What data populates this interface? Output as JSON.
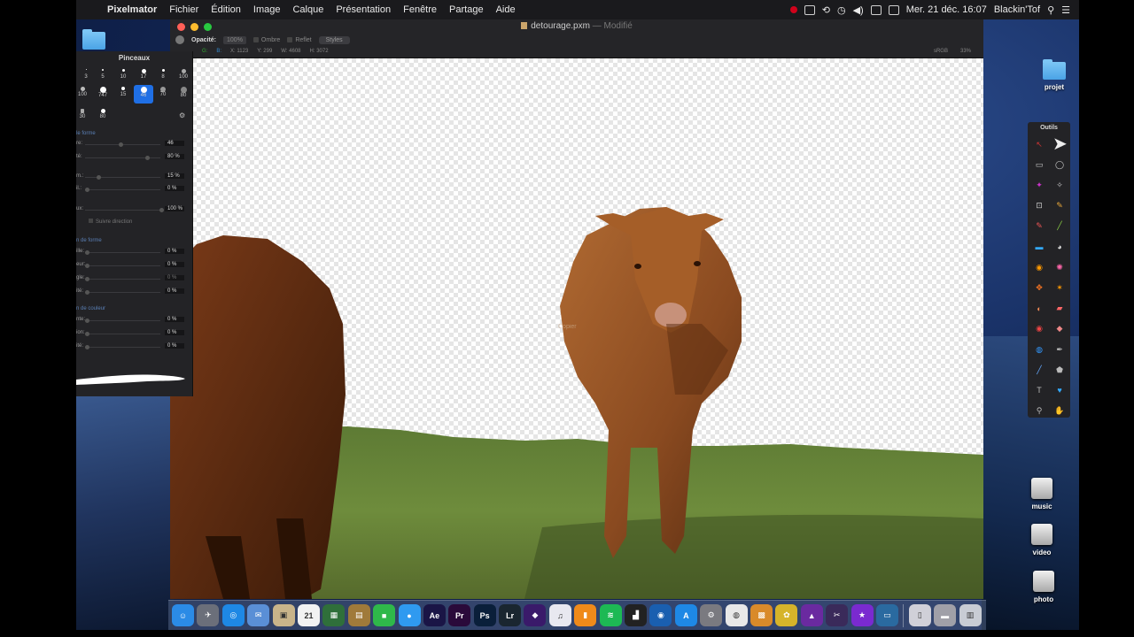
{
  "menubar": {
    "app_name": "Pixelmator",
    "items": [
      "Fichier",
      "Édition",
      "Image",
      "Calque",
      "Présentation",
      "Fenêtre",
      "Partage",
      "Aide"
    ],
    "status_icons": [
      "record-icon",
      "screen-mirror-icon",
      "time-machine-icon",
      "clock-icon",
      "volume-icon",
      "input-menu-icon",
      "battery-icon"
    ],
    "datetime": "Mer. 21 déc. 16:07",
    "user": "Blackin'Tof"
  },
  "window": {
    "title": "detourage.pxm",
    "title_suffix": "— Modifié",
    "toolbar": {
      "opacity_label": "Opacité:",
      "opacity_value": "100%",
      "shadow_label": "Ombre",
      "reflection_label": "Reflet",
      "styles_label": "Styles"
    },
    "info": {
      "g": "G:",
      "b": "B:",
      "x": "X: 1123",
      "y": "Y: 299",
      "w": "W: 4608",
      "h": "H: 3072",
      "color_profile": "sRGB",
      "zoom": "33%"
    },
    "canvas_hint": "Copier"
  },
  "brushes_panel": {
    "title": "Pinceaux",
    "brushes": [
      "3",
      "5",
      "10",
      "17",
      "8",
      "100",
      "100",
      "747",
      "15",
      "46",
      "70",
      "80",
      "30",
      "80"
    ],
    "selected_brush": "46",
    "section_shape": "le forme",
    "sliders_top": [
      {
        "label": "re:",
        "value": "46",
        "knob": 0.45
      },
      {
        "label": "té:",
        "value": "80 %",
        "knob": 0.8
      }
    ],
    "sliders_mid": [
      {
        "label": "m.:",
        "value": "15 %",
        "knob": 0.2
      },
      {
        "label": "il.:",
        "value": "0 %",
        "knob": 0.0
      }
    ],
    "slider_flux": {
      "label": "ux:",
      "value": "100 %",
      "knob": 1.0
    },
    "follow_direction": "Suivre direction",
    "section_shape_dyn": "n de forme",
    "sliders_shape": [
      {
        "label": "ille:",
        "value": "0 %"
      },
      {
        "label": "eur:",
        "value": "0 %"
      },
      {
        "label": "gle:",
        "value": "0 %"
      },
      {
        "label": "ité:",
        "value": "0 %"
      }
    ],
    "section_color": "n de couleur",
    "sliders_color": [
      {
        "label": "nte:",
        "value": "0 %"
      },
      {
        "label": "ion:",
        "value": "0 %"
      },
      {
        "label": "ité:",
        "value": "0 %"
      }
    ]
  },
  "tools_panel": {
    "title": "Outils",
    "tools": [
      "move-icon",
      "select-icon",
      "rect-select-icon",
      "ellipse-select-icon",
      "magic-wand-icon",
      "lasso-icon",
      "crop-icon",
      "eyedropper-icon",
      "pencil-icon",
      "brush-icon",
      "fill-icon",
      "gradient-icon",
      "blob-icon",
      "clone-icon",
      "smudge-icon",
      "burn-icon",
      "sponge-icon",
      "eraser-icon",
      "redeye-icon",
      "healing-icon",
      "drop-icon",
      "pen-icon",
      "line-icon",
      "shape-icon",
      "text-icon",
      "heart-shape-icon",
      "zoom-icon",
      "hand-icon"
    ]
  },
  "desktop_icons": [
    {
      "label": "",
      "kind": "folder"
    },
    {
      "label": "projet",
      "kind": "folder"
    },
    {
      "label": "music",
      "kind": "drive"
    },
    {
      "label": "video",
      "kind": "drive"
    },
    {
      "label": "photo",
      "kind": "drive"
    }
  ],
  "dock": {
    "apps": [
      {
        "name": "finder-icon",
        "glyph": "☺",
        "color": "#2b8be6"
      },
      {
        "name": "launchpad-icon",
        "glyph": "✈",
        "color": "#6b6f7a"
      },
      {
        "name": "safari-icon",
        "glyph": "◎",
        "color": "#1e88e5"
      },
      {
        "name": "mail-icon",
        "glyph": "✉",
        "color": "#5a8fd6"
      },
      {
        "name": "preview-icon",
        "glyph": "▣",
        "color": "#c9b48a"
      },
      {
        "name": "calendar-icon",
        "glyph": "21",
        "color": "#f2f2f2"
      },
      {
        "name": "mosaic-icon",
        "glyph": "▦",
        "color": "#2f6f3a"
      },
      {
        "name": "notes-icon",
        "glyph": "▤",
        "color": "#a07a3a"
      },
      {
        "name": "facetime-icon",
        "glyph": "■",
        "color": "#2fb84a"
      },
      {
        "name": "messages-icon",
        "glyph": "●",
        "color": "#2f9af0"
      },
      {
        "name": "after-effects-icon",
        "glyph": "Ae",
        "color": "#1a1546"
      },
      {
        "name": "premiere-icon",
        "glyph": "Pr",
        "color": "#2a0a3a"
      },
      {
        "name": "photoshop-icon",
        "glyph": "Ps",
        "color": "#0a1f3a"
      },
      {
        "name": "lightroom-icon",
        "glyph": "Lr",
        "color": "#1a2630"
      },
      {
        "name": "motion-icon",
        "glyph": "◆",
        "color": "#3a1a6a"
      },
      {
        "name": "itunes-icon",
        "glyph": "♫",
        "color": "#e8e8f0"
      },
      {
        "name": "ibooks-icon",
        "glyph": "▮",
        "color": "#f08a1a"
      },
      {
        "name": "spotify-icon",
        "glyph": "≋",
        "color": "#1db954"
      },
      {
        "name": "activity-icon",
        "glyph": "▟",
        "color": "#222222"
      },
      {
        "name": "network-icon",
        "glyph": "◉",
        "color": "#1a5fb0"
      },
      {
        "name": "app-store-icon",
        "glyph": "A",
        "color": "#1e88e5"
      },
      {
        "name": "system-prefs-icon",
        "glyph": "⚙",
        "color": "#7a7a80"
      },
      {
        "name": "chrome-icon",
        "glyph": "◍",
        "color": "#e8e8e8"
      },
      {
        "name": "image-capture-icon",
        "glyph": "▩",
        "color": "#d98a2a"
      },
      {
        "name": "pixelmator-icon",
        "glyph": "✿",
        "color": "#d6b42a"
      },
      {
        "name": "affinity-icon",
        "glyph": "▲",
        "color": "#6a2aa0"
      },
      {
        "name": "final-cut-icon",
        "glyph": "✂",
        "color": "#3a2a5a"
      },
      {
        "name": "imovie-icon",
        "glyph": "★",
        "color": "#7a2ad0"
      },
      {
        "name": "screen-sharing-icon",
        "glyph": "▭",
        "color": "#2a6aa0"
      },
      {
        "name": "documents-stack-icon",
        "glyph": "▯",
        "color": "#d0d0d8"
      },
      {
        "name": "downloads-stack-icon",
        "glyph": "▬",
        "color": "#a0a0a8"
      },
      {
        "name": "trash-icon",
        "glyph": "▥",
        "color": "#c8ccd4"
      }
    ]
  },
  "colors": {
    "accent": "#1f6fe5",
    "close": "#ff5f57",
    "minimize": "#febc2e",
    "maximize": "#28c840"
  }
}
